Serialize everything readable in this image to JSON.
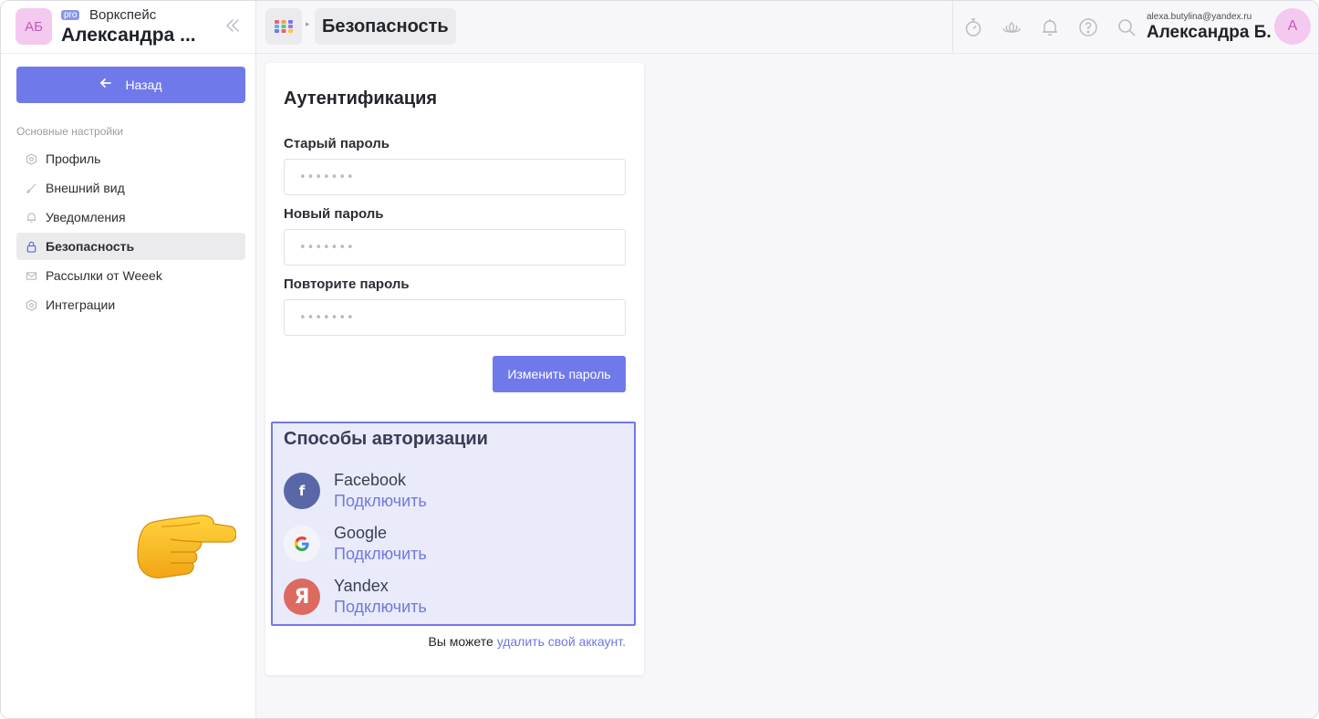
{
  "workspace": {
    "avatar_initials": "АБ",
    "badge": "pro",
    "label": "Воркспейс",
    "name": "Александра ..."
  },
  "sidebar": {
    "back_label": "Назад",
    "section_title": "Основные настройки",
    "items": [
      {
        "label": "Профиль",
        "icon": "hexagon-icon",
        "active": false
      },
      {
        "label": "Внешний вид",
        "icon": "brush-icon",
        "active": false
      },
      {
        "label": "Уведомления",
        "icon": "bell-icon",
        "active": false
      },
      {
        "label": "Безопасность",
        "icon": "lock-icon",
        "active": true
      },
      {
        "label": "Рассылки от Weeek",
        "icon": "mail-icon",
        "active": false
      },
      {
        "label": "Интеграции",
        "icon": "hexagon-icon",
        "active": false
      }
    ]
  },
  "header": {
    "breadcrumb": "Безопасность",
    "icons": [
      "stopwatch-icon",
      "lotus-icon",
      "bell-icon",
      "help-icon",
      "search-icon"
    ],
    "user_email": "alexa.butylina@yandex.ru",
    "user_name": "Александра Б.",
    "user_avatar_initial": "A"
  },
  "auth": {
    "title": "Аутентификация",
    "old_password_label": "Старый пароль",
    "new_password_label": "Новый пароль",
    "repeat_password_label": "Повторите пароль",
    "password_mask": "•••••••",
    "change_button": "Изменить пароль"
  },
  "auth_methods": {
    "title": "Способы авторизации",
    "providers": [
      {
        "name": "Facebook",
        "action": "Подключить",
        "logo_letter": "f",
        "color": "#5a67a6"
      },
      {
        "name": "Google",
        "action": "Подключить",
        "logo_letter": "G",
        "color": "#ffffff"
      },
      {
        "name": "Yandex",
        "action": "Подключить",
        "logo_letter": "Я",
        "color": "#dc6a60"
      }
    ]
  },
  "delete_account": {
    "prefix": "Вы можете ",
    "link": "удалить свой аккаунт."
  },
  "colors": {
    "accent": "#7079ea",
    "highlight_border": "#7179e6",
    "highlight_bg": "#e9ebfb"
  }
}
